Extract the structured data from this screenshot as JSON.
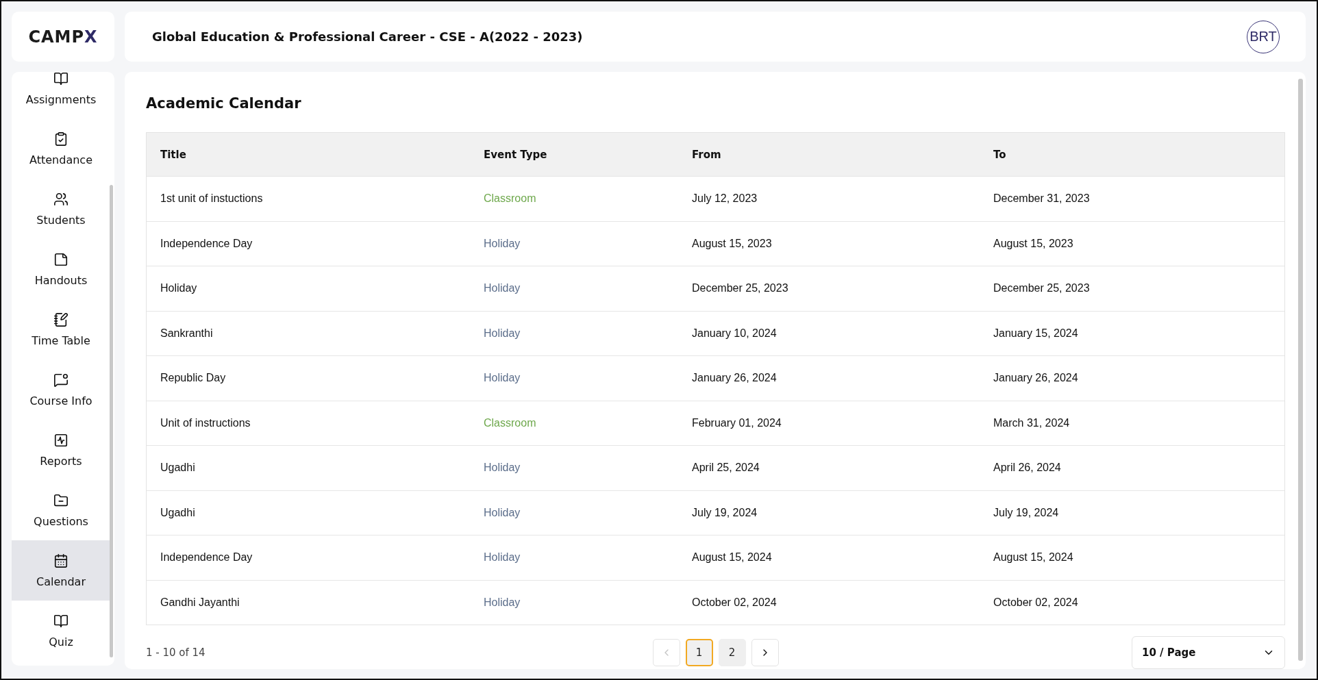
{
  "logo": {
    "text": "CAMP",
    "accent": "X"
  },
  "sidebar": {
    "items": [
      {
        "label": "Assignments",
        "selected": false
      },
      {
        "label": "Attendance",
        "selected": false
      },
      {
        "label": "Students",
        "selected": false
      },
      {
        "label": "Handouts",
        "selected": false
      },
      {
        "label": "Time Table",
        "selected": false
      },
      {
        "label": "Course Info",
        "selected": false
      },
      {
        "label": "Reports",
        "selected": false
      },
      {
        "label": "Questions",
        "selected": false
      },
      {
        "label": "Calendar",
        "selected": true
      },
      {
        "label": "Quiz",
        "selected": false
      }
    ]
  },
  "header": {
    "title": "Global Education & Professional Career - CSE - A(2022 - 2023)",
    "avatar": "BRT"
  },
  "page_title": "Academic Calendar",
  "table": {
    "columns": [
      "Title",
      "Event Type",
      "From",
      "To"
    ],
    "rows": [
      {
        "title": "1st unit of instuctions",
        "event_type": "Classroom",
        "color": "#6ea84c",
        "from": "July 12, 2023",
        "to": "December 31, 2023"
      },
      {
        "title": "Independence Day",
        "event_type": "Holiday",
        "color": "#5b6d8a",
        "from": "August 15, 2023",
        "to": "August 15, 2023"
      },
      {
        "title": "Holiday",
        "event_type": "Holiday",
        "color": "#5b6d8a",
        "from": "December 25, 2023",
        "to": "December 25, 2023"
      },
      {
        "title": "Sankranthi",
        "event_type": "Holiday",
        "color": "#5b6d8a",
        "from": "January 10, 2024",
        "to": "January 15, 2024"
      },
      {
        "title": "Republic Day",
        "event_type": "Holiday",
        "color": "#5b6d8a",
        "from": "January 26, 2024",
        "to": "January 26, 2024"
      },
      {
        "title": "Unit of instructions",
        "event_type": "Classroom",
        "color": "#6ea84c",
        "from": "February 01, 2024",
        "to": "March 31, 2024"
      },
      {
        "title": "Ugadhi",
        "event_type": "Holiday",
        "color": "#5b6d8a",
        "from": "April 25, 2024",
        "to": "April 26, 2024"
      },
      {
        "title": "Ugadhi",
        "event_type": "Holiday",
        "color": "#5b6d8a",
        "from": "July 19, 2024",
        "to": "July 19, 2024"
      },
      {
        "title": "Independence Day",
        "event_type": "Holiday",
        "color": "#5b6d8a",
        "from": "August 15, 2024",
        "to": "August 15, 2024"
      },
      {
        "title": "Gandhi Jayanthi",
        "event_type": "Holiday",
        "color": "#5b6d8a",
        "from": "October 02, 2024",
        "to": "October 02, 2024"
      }
    ]
  },
  "pagination": {
    "range": "1 - 10 of 14",
    "prev_disabled": true,
    "next_disabled": false,
    "pages": [
      {
        "label": "1",
        "selected": true
      },
      {
        "label": "2",
        "selected": false
      }
    ],
    "page_size": "10 / Page"
  }
}
